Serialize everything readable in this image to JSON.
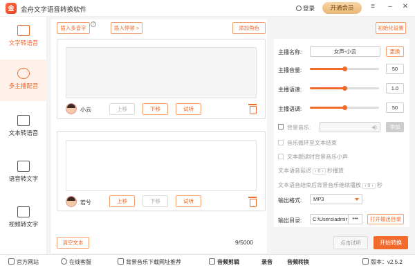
{
  "app": {
    "logo": "金",
    "title": "金舟文字语音转换软件"
  },
  "titlebar": {
    "login": "登录",
    "vip": "开通会员",
    "menu_icon": "menu-icon",
    "min_icon": "minimize-icon",
    "close_icon": "close-icon"
  },
  "sidebar": {
    "items": [
      {
        "label": "文字转语音",
        "icon": "text-to-speech-icon"
      },
      {
        "label": "多主播配音",
        "icon": "multi-anchor-icon"
      },
      {
        "label": "文本转语音",
        "icon": "document-icon"
      },
      {
        "label": "语音转文字",
        "icon": "speech-to-text-icon"
      },
      {
        "label": "视频转文字",
        "icon": "video-to-text-icon"
      }
    ]
  },
  "toolbar": {
    "insert_polyphone": "插入多音字",
    "help": "?",
    "insert_pause": "插入停顿 >",
    "add_role": "添加角色",
    "init_settings": "初始化设置"
  },
  "cards": [
    {
      "voice": "小云",
      "up": "上移",
      "down": "下移",
      "audition": "试听",
      "text": ""
    },
    {
      "voice": "若兮",
      "up": "上移",
      "down": "下移",
      "audition": "试听",
      "text": ""
    }
  ],
  "footer_main": {
    "clear": "清空文本",
    "counter": "9/5000",
    "preview": "点击试听",
    "start": "开始转换"
  },
  "panel": {
    "anchor_name_label": "主播名称:",
    "anchor_name": "女声-小云",
    "change": "更换",
    "volume_label": "主播音量:",
    "volume": "50",
    "volume_level": 0.5,
    "speed_label": "主播语速:",
    "speed": "1.0",
    "speed_level": 0.5,
    "pitch_label": "主播语调:",
    "pitch": "50",
    "pitch_level": 0.5,
    "bgm_label": "背景音乐:",
    "bgm_add": "添加",
    "loop_label": "音乐循环至文本结束",
    "lower_label": "文本朗读时背景音乐小声",
    "delay_label": "文本语音延迟",
    "delay_value": "‹ 0 ›",
    "delay_suffix": "秒播放",
    "continue_label": "文本语音结束后背景音乐继续播放",
    "continue_value": "‹ 0 ›",
    "continue_suffix": "秒",
    "format_label": "输出格式:",
    "format": "MP3",
    "dir_label": "输出目录:",
    "dir": "C:\\Users\\admir",
    "dir_dots": "•••",
    "open_dir": "打开输出目录"
  },
  "bottombar": {
    "website": "官方网站",
    "service": "在线客服",
    "bgm_download": "背景音乐下载网址推荐",
    "audio_cut": "音频剪辑",
    "record": "录音",
    "audio_convert": "音频转换",
    "version": "版本：v2.5.2"
  },
  "colors": {
    "accent": "#f06a2a",
    "vip": "#e9b775"
  }
}
